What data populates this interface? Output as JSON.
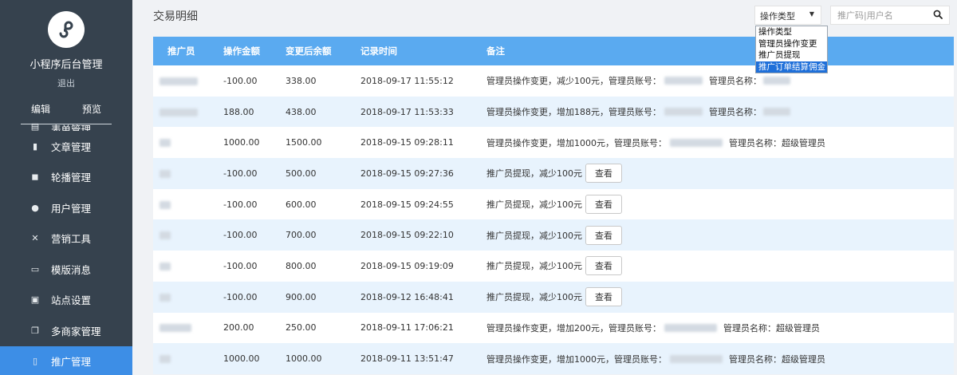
{
  "sidebar": {
    "app_title": "小程序后台管理",
    "logout": "退出",
    "tabs": [
      {
        "label": "编辑"
      },
      {
        "label": "预览"
      }
    ],
    "items": [
      {
        "label": "表单管理",
        "icon": "form-icon"
      },
      {
        "label": "文章管理",
        "icon": "document-icon"
      },
      {
        "label": "轮播管理",
        "icon": "carousel-icon"
      },
      {
        "label": "用户管理",
        "icon": "user-icon"
      },
      {
        "label": "营销工具",
        "icon": "tools-icon"
      },
      {
        "label": "模版消息",
        "icon": "message-icon"
      },
      {
        "label": "站点设置",
        "icon": "image-icon"
      },
      {
        "label": "多商家管理",
        "icon": "merchant-icon"
      },
      {
        "label": "推广管理",
        "icon": "mobile-icon",
        "active": true
      }
    ]
  },
  "main": {
    "title": "交易明细",
    "type_select": {
      "value": "操作类型",
      "options": [
        "操作类型",
        "管理员操作变更",
        "推广员提现",
        "推广订单结算佣金"
      ],
      "highlighted": 3
    },
    "search": {
      "placeholder": "推广码|用户名"
    },
    "colors": {
      "header": "#5aaaf0",
      "accent": "#3d8ee6",
      "stripe": "#e8f3fd"
    },
    "table": {
      "headers": [
        "推广员",
        "操作金额",
        "变更后余额",
        "记录时间",
        "备注"
      ],
      "rows": [
        {
          "amount": "-100.00",
          "balance": "338.00",
          "time": "2018-09-17 11:55:12",
          "note": "管理员操作变更，减少100元，管理员账号：",
          "admin_name_label": "管理员名称：",
          "admin_name": ""
        },
        {
          "amount": "188.00",
          "balance": "438.00",
          "time": "2018-09-17 11:53:33",
          "note": "管理员操作变更，增加188元，管理员账号：",
          "admin_name_label": "管理员名称：",
          "admin_name": ""
        },
        {
          "amount": "1000.00",
          "balance": "1500.00",
          "time": "2018-09-15 09:28:11",
          "note": "管理员操作变更，增加1000元，管理员账号：",
          "admin_name_label": "管理员名称：",
          "admin_name": "超级管理员"
        },
        {
          "amount": "-100.00",
          "balance": "500.00",
          "time": "2018-09-15 09:27:36",
          "note": "推广员提现，减少100元",
          "button": "查看"
        },
        {
          "amount": "-100.00",
          "balance": "600.00",
          "time": "2018-09-15 09:24:55",
          "note": "推广员提现，减少100元",
          "button": "查看"
        },
        {
          "amount": "-100.00",
          "balance": "700.00",
          "time": "2018-09-15 09:22:10",
          "note": "推广员提现，减少100元",
          "button": "查看"
        },
        {
          "amount": "-100.00",
          "balance": "800.00",
          "time": "2018-09-15 09:19:09",
          "note": "推广员提现，减少100元",
          "button": "查看"
        },
        {
          "amount": "-100.00",
          "balance": "900.00",
          "time": "2018-09-12 16:48:41",
          "note": "推广员提现，减少100元",
          "button": "查看"
        },
        {
          "amount": "200.00",
          "balance": "250.00",
          "time": "2018-09-11 17:06:21",
          "note": "管理员操作变更，增加200元，管理员账号：",
          "admin_name_label": "管理员名称：",
          "admin_name": "超级管理员"
        },
        {
          "amount": "1000.00",
          "balance": "1000.00",
          "time": "2018-09-11 13:51:47",
          "note": "管理员操作变更，增加1000元，管理员账号：",
          "admin_name_label": "管理员名称：",
          "admin_name": "超级管理员"
        }
      ]
    }
  }
}
